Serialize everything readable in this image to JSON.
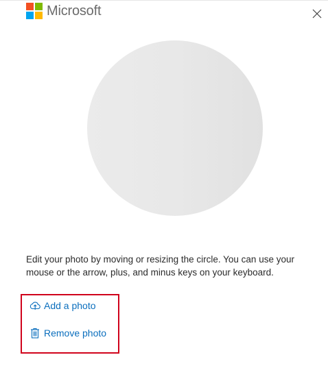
{
  "header": {
    "brand": "Microsoft",
    "brand_colors": [
      "#f25022",
      "#7fba00",
      "#00a4ef",
      "#ffb900"
    ],
    "close_icon": "close-icon"
  },
  "main": {
    "photo_placeholder": "empty-photo-circle",
    "instructions": "Edit your photo by moving or resizing the circle. You can use your mouse or the arrow, plus, and minus keys on your keyboard."
  },
  "actions": {
    "add_label": "Add a photo",
    "add_icon": "cloud-upload-icon",
    "remove_label": "Remove photo",
    "remove_icon": "trash-icon"
  },
  "colors": {
    "link": "#0a6ebd",
    "highlight": "#d0021b",
    "circle": "#e6e6e6"
  }
}
